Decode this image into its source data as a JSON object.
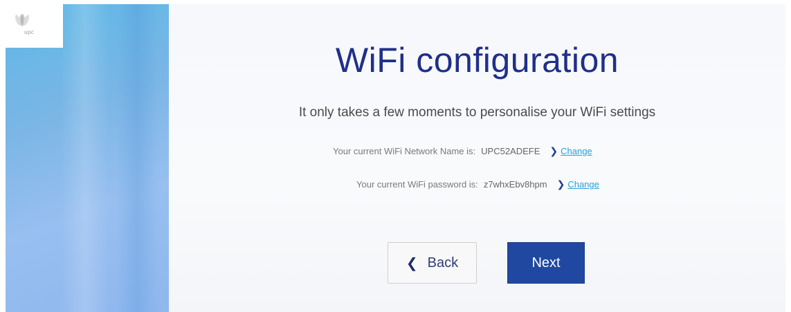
{
  "brand": {
    "logo_text": "upc",
    "icon": "upc-logo-icon"
  },
  "page": {
    "title": "WiFi configuration",
    "subtitle": "It only takes a few moments to personalise your WiFi settings"
  },
  "network": {
    "label": "Your current WiFi Network Name is:",
    "value": "UPC52ADEFE",
    "change_icon": "chevron-right-icon",
    "change_label": "Change"
  },
  "password": {
    "label": "Your current WiFi password is:",
    "value": "z7whxEbv8hpm",
    "change_icon": "chevron-right-icon",
    "change_label": "Change"
  },
  "buttons": {
    "back_icon": "chevron-left-icon",
    "back_label": "Back",
    "next_label": "Next"
  },
  "colors": {
    "title": "#1f2f8a",
    "next_button": "#2048a0",
    "link": "#29a0d8",
    "side_panel": "#7ab6e6"
  }
}
